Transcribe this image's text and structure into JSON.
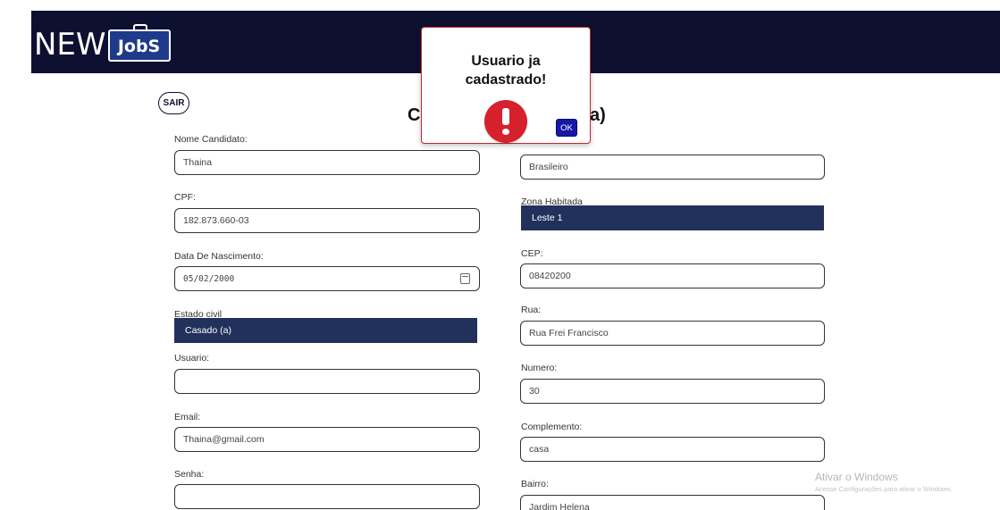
{
  "header": {
    "logo_new": "NEW",
    "logo_jobs": "JobS"
  },
  "sair_label": "SAIR",
  "form_title": {
    "left": "Ca",
    "right": "a)"
  },
  "left_fields": [
    {
      "label": "Nome Candidato:",
      "value": "Thaina"
    },
    {
      "label": "CPF:",
      "value": "182.873.660-03"
    },
    {
      "label": "Data De Nascimento:",
      "value": "05/02/2000"
    },
    {
      "label": "Estado civil",
      "value": "Casado (a)"
    },
    {
      "label": "Usuario:",
      "value": ""
    },
    {
      "label": "Email:",
      "value": "Thaina@gmail.com"
    },
    {
      "label": "Senha:",
      "value": ""
    }
  ],
  "right_fields": [
    {
      "label": "",
      "value": "Brasileiro"
    },
    {
      "label": "Zona Habitada",
      "value": "Leste 1"
    },
    {
      "label": "CEP:",
      "value": "08420200"
    },
    {
      "label": "Rua:",
      "value": "Rua Frei Francisco"
    },
    {
      "label": "Numero:",
      "value": "30"
    },
    {
      "label": "Complemento:",
      "value": "casa"
    },
    {
      "label": "Bairro:",
      "value": "Jardim Helena"
    }
  ],
  "modal": {
    "title_line1": "Usuario ja",
    "title_line2": "cadastrado!",
    "ok_label": "OK",
    "icon": "exclamation-circle-icon",
    "accent": "#d6202c"
  },
  "watermark": {
    "title": "Ativar o Windows",
    "subtitle": "Acesse Configurações para ativar o Windows."
  },
  "colors": {
    "header_bg": "#0d1030",
    "select_bg": "#22305c",
    "ok_button": "#1717a8"
  }
}
